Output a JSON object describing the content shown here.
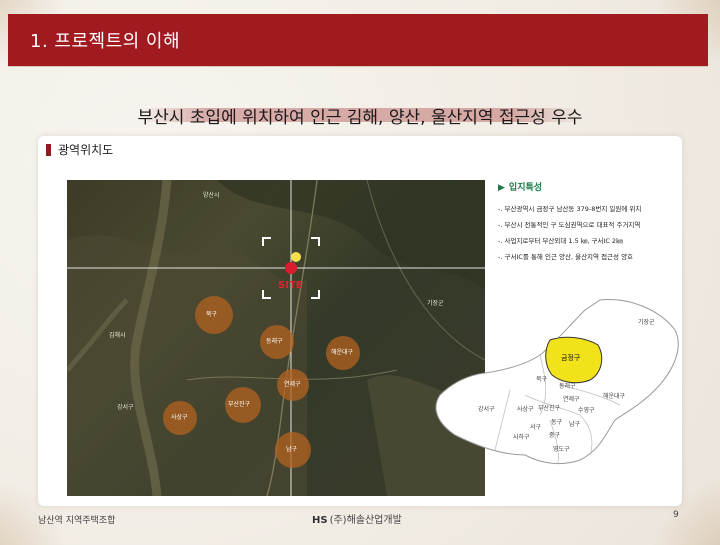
{
  "header": {
    "title": "1. 프로젝트의 이해"
  },
  "headline": "부산시 초입에 위치하여 인근 김해, 양산, 울산지역 접근성 우수",
  "section": {
    "title": "광역위치도"
  },
  "map": {
    "site_label": "SITE",
    "districts": [
      "북구",
      "동래구",
      "해운대구",
      "연제구",
      "부산진구",
      "사상구",
      "서구",
      "남구"
    ],
    "place_labels": [
      "양산시",
      "기장군",
      "김해시",
      "강서구",
      "사하구",
      "수영구"
    ]
  },
  "features": {
    "title": "입지특성",
    "items": [
      "-. 부산광역시 금정구 남산동 379-8번지 일원에 위치",
      "-. 부산시 전통적인 구 도심권역으로 대표적 주거지역",
      "-. 사업지로부터 부산외대 1.5 ㎞, 구서IC 2㎞",
      "-. 구서IC를 통해 인근 양산, 울산지역 접근성 양호"
    ]
  },
  "district_map": {
    "highlight": "금정구",
    "highlight_color": "#f2e21a",
    "labels": [
      "기장군",
      "북구",
      "동래구",
      "해운대구",
      "강서구",
      "사상구",
      "연제구",
      "부산진구",
      "수영구",
      "서구",
      "동구",
      "남구",
      "사하구",
      "중구",
      "영도구"
    ]
  },
  "footer": {
    "left": "남산역 지역주택조합",
    "logo": "HS",
    "company": "(주)해솔산업개발",
    "page_number": "9"
  },
  "colors": {
    "brand": "#a11a20",
    "feature_title": "#1f7a4a"
  }
}
